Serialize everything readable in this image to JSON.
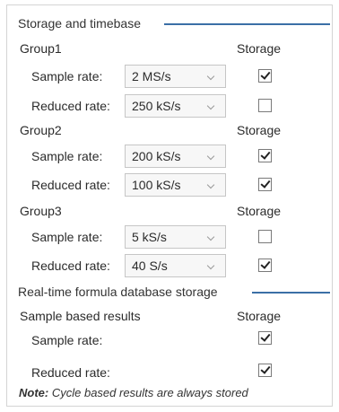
{
  "storage_timebase": {
    "title": "Storage and timebase",
    "storage_label": "Storage",
    "groups": [
      {
        "name": "Group1",
        "sample_rate_label": "Sample rate:",
        "sample_rate": "2 MS/s",
        "sample_storage": true,
        "reduced_rate_label": "Reduced rate:",
        "reduced_rate": "250 kS/s",
        "reduced_storage": false
      },
      {
        "name": "Group2",
        "sample_rate_label": "Sample rate:",
        "sample_rate": "200 kS/s",
        "sample_storage": true,
        "reduced_rate_label": "Reduced rate:",
        "reduced_rate": "100 kS/s",
        "reduced_storage": true
      },
      {
        "name": "Group3",
        "sample_rate_label": "Sample rate:",
        "sample_rate": "5 kS/s",
        "sample_storage": false,
        "reduced_rate_label": "Reduced rate:",
        "reduced_rate": "40 S/s",
        "reduced_storage": true
      }
    ]
  },
  "realtime": {
    "title": "Real-time formula database storage",
    "sample_based_label": "Sample based results",
    "storage_label": "Storage",
    "sample_rate_label": "Sample rate:",
    "sample_storage": true,
    "reduced_rate_label": "Reduced rate:",
    "reduced_storage": true,
    "note_prefix": "Note:",
    "note_text": "Cycle based results are always stored"
  },
  "colors": {
    "section_line": "#3b6fa6",
    "dropdown_bg": "#f7f7f7"
  }
}
